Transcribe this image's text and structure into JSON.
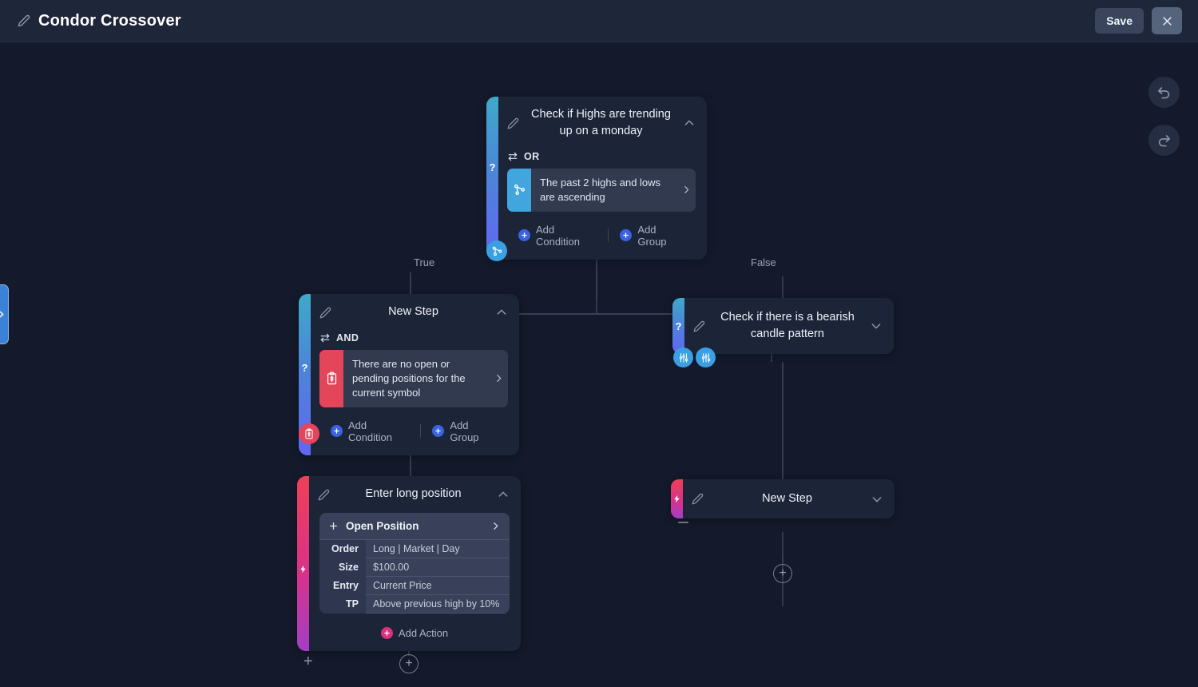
{
  "header": {
    "title": "Condor Crossover",
    "edit_icon": "pencil-icon",
    "save_label": "Save",
    "close_icon": "close-icon"
  },
  "toolbar": {
    "undo_icon": "undo-icon",
    "redo_icon": "redo-icon",
    "panel_toggle_icon": "chevron-right-icon"
  },
  "branches": {
    "true_label": "True",
    "false_label": "False"
  },
  "nodes": {
    "root": {
      "title": "Check if Highs are trending up on a monday",
      "logic": "OR",
      "conditions": [
        {
          "text": "The past 2 highs and lows are ascending",
          "icon": "flow-nodes-icon",
          "color": "#42a5dd"
        }
      ],
      "add_condition": "Add Condition",
      "add_group": "Add Group",
      "accent_glyph": "?"
    },
    "left_step": {
      "title": "New Step",
      "logic": "AND",
      "conditions": [
        {
          "text": "There are no open or pending positions for the current symbol",
          "icon": "clipboard-dollar-icon",
          "color": "#e3455a"
        }
      ],
      "add_condition": "Add Condition",
      "add_group": "Add Group",
      "accent_glyph": "?"
    },
    "right_step": {
      "title": "Check if there is a bearish candle pattern",
      "accent_glyph": "?"
    },
    "long_position": {
      "title": "Enter long position",
      "action_title": "Open Position",
      "rows": [
        {
          "key": "Order",
          "value": "Long | Market | Day"
        },
        {
          "key": "Size",
          "value": "$100.00"
        },
        {
          "key": "Entry",
          "value": "Current Price"
        },
        {
          "key": "TP",
          "value": "Above previous high by 10%"
        }
      ],
      "add_action": "Add Action",
      "accent_glyph": "lightning-icon"
    },
    "right_new_step": {
      "title": "New Step",
      "accent_glyph": "lightning-icon"
    }
  },
  "badges": {
    "root_connector": "flow-nodes-icon",
    "left_step_condition": "clipboard-dollar-icon",
    "right_settings_1": "sliders-icon",
    "right_settings_2": "sliders-icon"
  },
  "colors": {
    "background": "#141a2b",
    "header": "#1e2639",
    "card": "#1c2438",
    "condition_row": "#313a4e",
    "accent_condition_start": "#3fa9c9",
    "accent_condition_end": "#6366f1",
    "accent_action_start": "#ef4056",
    "accent_action_end": "#a33fc4",
    "blue_badge": "#3aa0e3",
    "red_badge": "#e3455a",
    "pink_plus": "#d9317f",
    "blue_plus": "#3b63e0"
  },
  "add_buttons": {
    "left_plain_plus": "+",
    "left_ring_plus": "+",
    "right_ring_plus": "+"
  }
}
